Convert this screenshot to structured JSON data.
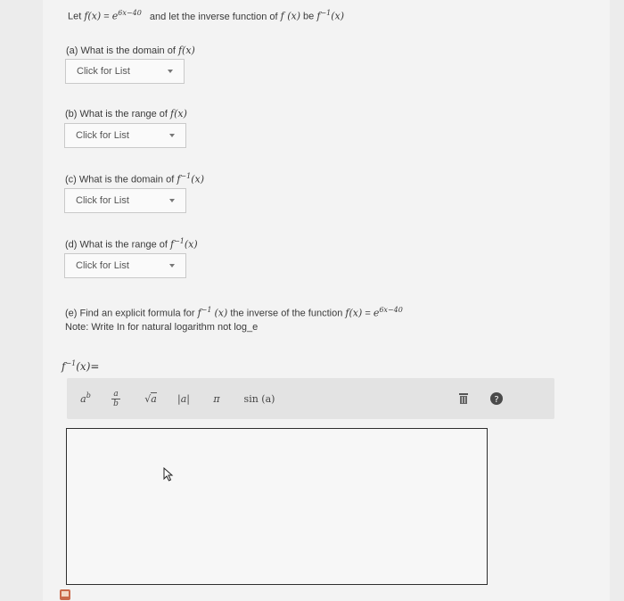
{
  "question": {
    "intro_lead": "Let",
    "intro_f": "f(x)",
    "intro_eq": "=",
    "intro_base": "e",
    "intro_exp": "6x−40",
    "intro_mid": "and let the inverse function of",
    "intro_fx": "f (x)",
    "intro_be": "be",
    "intro_inv": "f",
    "intro_inv_exp": "−1",
    "intro_inv_arg": "(x)"
  },
  "parts": {
    "a": {
      "label": "(a) What is the domain of",
      "fn": "f(x)",
      "dropdown": "Click for List"
    },
    "b": {
      "label": "(b) What is the range of",
      "fn": "f(x)",
      "dropdown": "Click for List"
    },
    "c": {
      "label": "(c) What is the domain of",
      "fn": "f",
      "fn_exp": "−1",
      "fn_arg": "(x)",
      "dropdown": "Click for List"
    },
    "d": {
      "label": "(d) What is the range of",
      "fn": "f",
      "fn_exp": "−1",
      "fn_arg": "(x)",
      "dropdown": "Click for List"
    },
    "e": {
      "label_start": "(e) Find an explicit formula for",
      "fn": "f",
      "fn_exp": "−1",
      "fn_arg": "(x)",
      "label_mid": "the inverse of the function",
      "f": "f(x)",
      "eq": "=",
      "base": "e",
      "exp": "6x−40",
      "note": "Note: Write In for natural logarithm not log_e"
    }
  },
  "answer_label": {
    "fn": "f",
    "exp": "−1",
    "arg": "(x)="
  },
  "toolbar": {
    "power_base": "a",
    "power_exp": "b",
    "frac_num": "a",
    "frac_den": "b",
    "sqrt_sym": "√",
    "sqrt_arg": "a",
    "abs": "|a|",
    "pi": "π",
    "sin": "sin (a)",
    "trash_icon": "trash-icon",
    "help_icon": "help-icon"
  }
}
